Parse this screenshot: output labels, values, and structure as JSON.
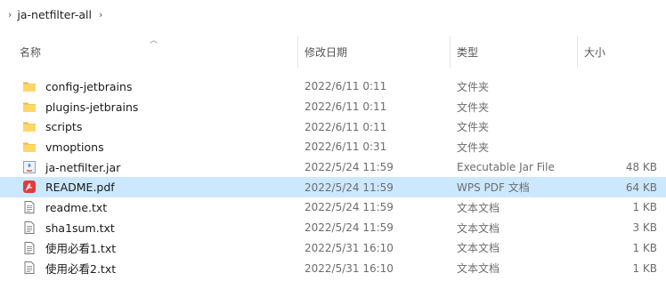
{
  "breadcrumb": {
    "path": "ja-netfilter-all"
  },
  "columns": {
    "name": "名称",
    "date": "修改日期",
    "type": "类型",
    "size": "大小"
  },
  "files": [
    {
      "icon": "folder",
      "name": "config-jetbrains",
      "date": "2022/6/11 0:11",
      "type": "文件夹",
      "size": ""
    },
    {
      "icon": "folder",
      "name": "plugins-jetbrains",
      "date": "2022/6/11 0:11",
      "type": "文件夹",
      "size": ""
    },
    {
      "icon": "folder",
      "name": "scripts",
      "date": "2022/6/11 0:11",
      "type": "文件夹",
      "size": ""
    },
    {
      "icon": "folder",
      "name": "vmoptions",
      "date": "2022/6/11 0:31",
      "type": "文件夹",
      "size": ""
    },
    {
      "icon": "jar",
      "name": "ja-netfilter.jar",
      "date": "2022/5/24 11:59",
      "type": "Executable Jar File",
      "size": "48 KB"
    },
    {
      "icon": "pdf",
      "name": "README.pdf",
      "date": "2022/5/24 11:59",
      "type": "WPS PDF 文档",
      "size": "64 KB",
      "selected": true
    },
    {
      "icon": "txt",
      "name": "readme.txt",
      "date": "2022/5/24 11:59",
      "type": "文本文档",
      "size": "1 KB"
    },
    {
      "icon": "txt",
      "name": "sha1sum.txt",
      "date": "2022/5/24 11:59",
      "type": "文本文档",
      "size": "3 KB"
    },
    {
      "icon": "txt",
      "name": "使用必看1.txt",
      "date": "2022/5/31 16:10",
      "type": "文本文档",
      "size": "1 KB"
    },
    {
      "icon": "txt",
      "name": "使用必看2.txt",
      "date": "2022/5/31 16:10",
      "type": "文本文档",
      "size": "1 KB"
    }
  ]
}
